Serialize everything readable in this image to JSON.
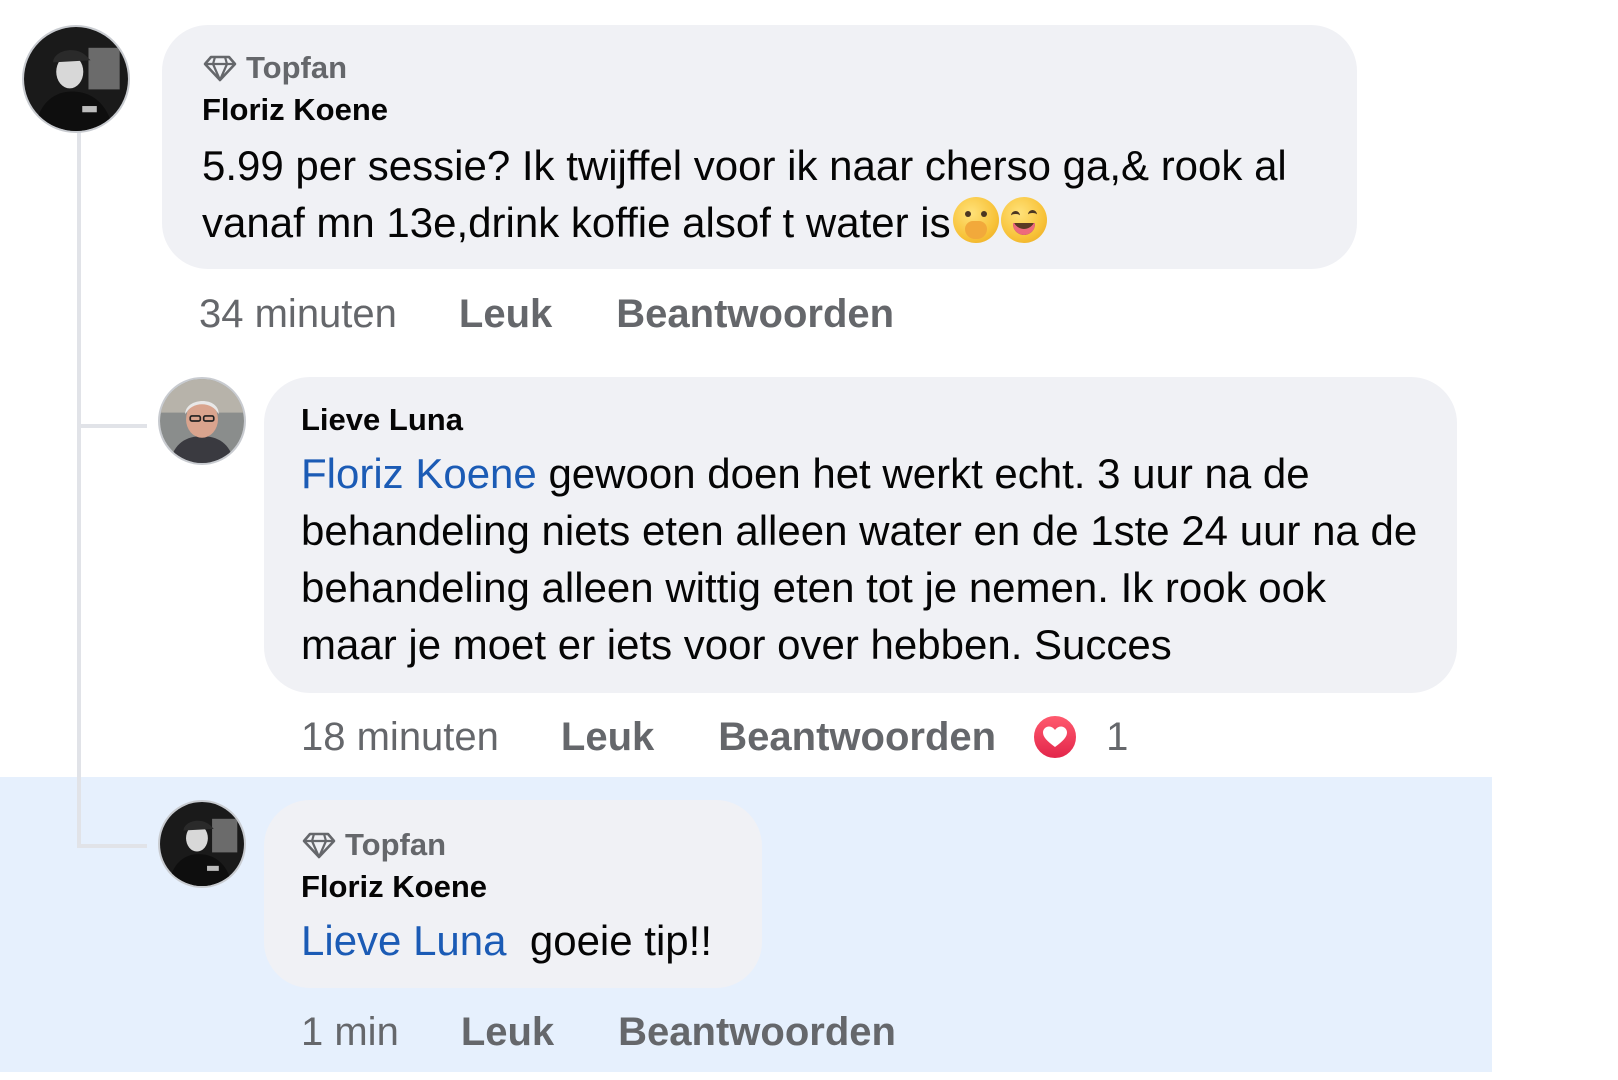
{
  "colors": {
    "highlight_background": "#e6f0fd",
    "bubble_background": "#f0f1f5",
    "mention": "#1b5bb5",
    "secondary_text": "#65676b",
    "heart_reaction": "#e3264b"
  },
  "comments": [
    {
      "badge_icon": "diamond-icon",
      "badge": "Topfan",
      "author": "Floriz Koene",
      "text": "5.99 per sessie? Ik twijffel voor ik naar cherso ga,& rook al vanaf mn 13e,drink koffie alsof t water is",
      "emojis": [
        "face-with-hand-over-mouth",
        "winking-face-with-tongue"
      ],
      "timestamp": "34 minuten",
      "like_label": "Leuk",
      "reply_label": "Beantwoorden"
    },
    {
      "author": "Lieve Luna",
      "mention": "Floriz Koene",
      "text": " gewoon doen het werkt echt. 3 uur na de behandeling niets eten alleen water en de 1ste 24 uur na de behandeling alleen wittig eten tot je nemen. Ik rook ook maar je moet er iets voor over hebben. Succes",
      "timestamp": "18 minuten",
      "like_label": "Leuk",
      "reply_label": "Beantwoorden",
      "reaction_icon": "heart-icon",
      "reaction_count": "1"
    },
    {
      "badge_icon": "diamond-icon",
      "badge": "Topfan",
      "author": "Floriz Koene",
      "mention": "Lieve Luna",
      "text": "  goeie tip!!",
      "timestamp": "1 min",
      "like_label": "Leuk",
      "reply_label": "Beantwoorden",
      "highlighted": true
    }
  ]
}
